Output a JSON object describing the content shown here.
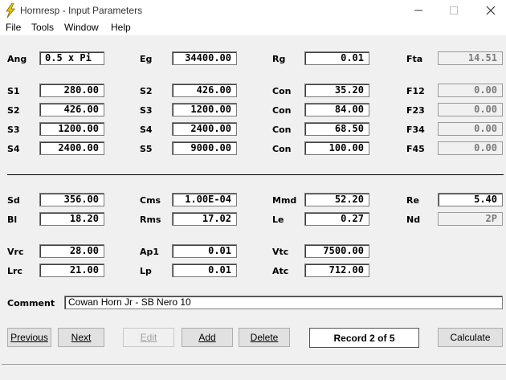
{
  "window": {
    "title": "Hornresp - Input Parameters"
  },
  "menu": [
    "File",
    "Tools",
    "Window",
    "Help"
  ],
  "fields": {
    "Ang": "0.5 x Pi",
    "Eg": "34400.00",
    "Rg": "0.01",
    "Fta": "14.51",
    "S1_a": "280.00",
    "S2_b": "426.00",
    "Con1": "35.20",
    "F12": "0.00",
    "S2_a": "426.00",
    "S3_b": "1200.00",
    "Con2": "84.00",
    "F23": "0.00",
    "S3_a": "1200.00",
    "S4_b": "2400.00",
    "Con3": "68.50",
    "F34": "0.00",
    "S4_a": "2400.00",
    "S5_b": "9000.00",
    "Con4": "100.00",
    "F45": "0.00",
    "Sd": "356.00",
    "Cms": "1.00E-04",
    "Mmd": "52.20",
    "Re": "5.40",
    "Bl": "18.20",
    "Rms": "17.02",
    "Le": "0.27",
    "Nd": "2P",
    "Vrc": "28.00",
    "Ap1": "0.01",
    "Vtc": "7500.00",
    "Lrc": "21.00",
    "Lp": "0.01",
    "Atc": "712.00",
    "Comment": "Cowan Horn Jr - SB Nero 10"
  },
  "labels": {
    "Ang": "Ang",
    "Eg": "Eg",
    "Rg": "Rg",
    "Fta": "Fta",
    "S1": "S1",
    "S2": "S2",
    "S3": "S3",
    "S4": "S4",
    "S5": "S5",
    "Con": "Con",
    "F12": "F12",
    "F23": "F23",
    "F34": "F34",
    "F45": "F45",
    "Sd": "Sd",
    "Cms": "Cms",
    "Mmd": "Mmd",
    "Re": "Re",
    "Bl": "Bl",
    "Rms": "Rms",
    "Le": "Le",
    "Nd": "Nd",
    "Vrc": "Vrc",
    "Ap1": "Ap1",
    "Vtc": "Vtc",
    "Lrc": "Lrc",
    "Lp": "Lp",
    "Atc": "Atc",
    "Comment": "Comment"
  },
  "buttons": {
    "previous": "Previous",
    "next": "Next",
    "edit": "Edit",
    "add": "Add",
    "delete": "Delete",
    "calculate": "Calculate"
  },
  "record": "Record 2 of 5",
  "colors": {
    "icon_yellow": "#f0c800",
    "readonly_text": "#7a7a7a"
  }
}
